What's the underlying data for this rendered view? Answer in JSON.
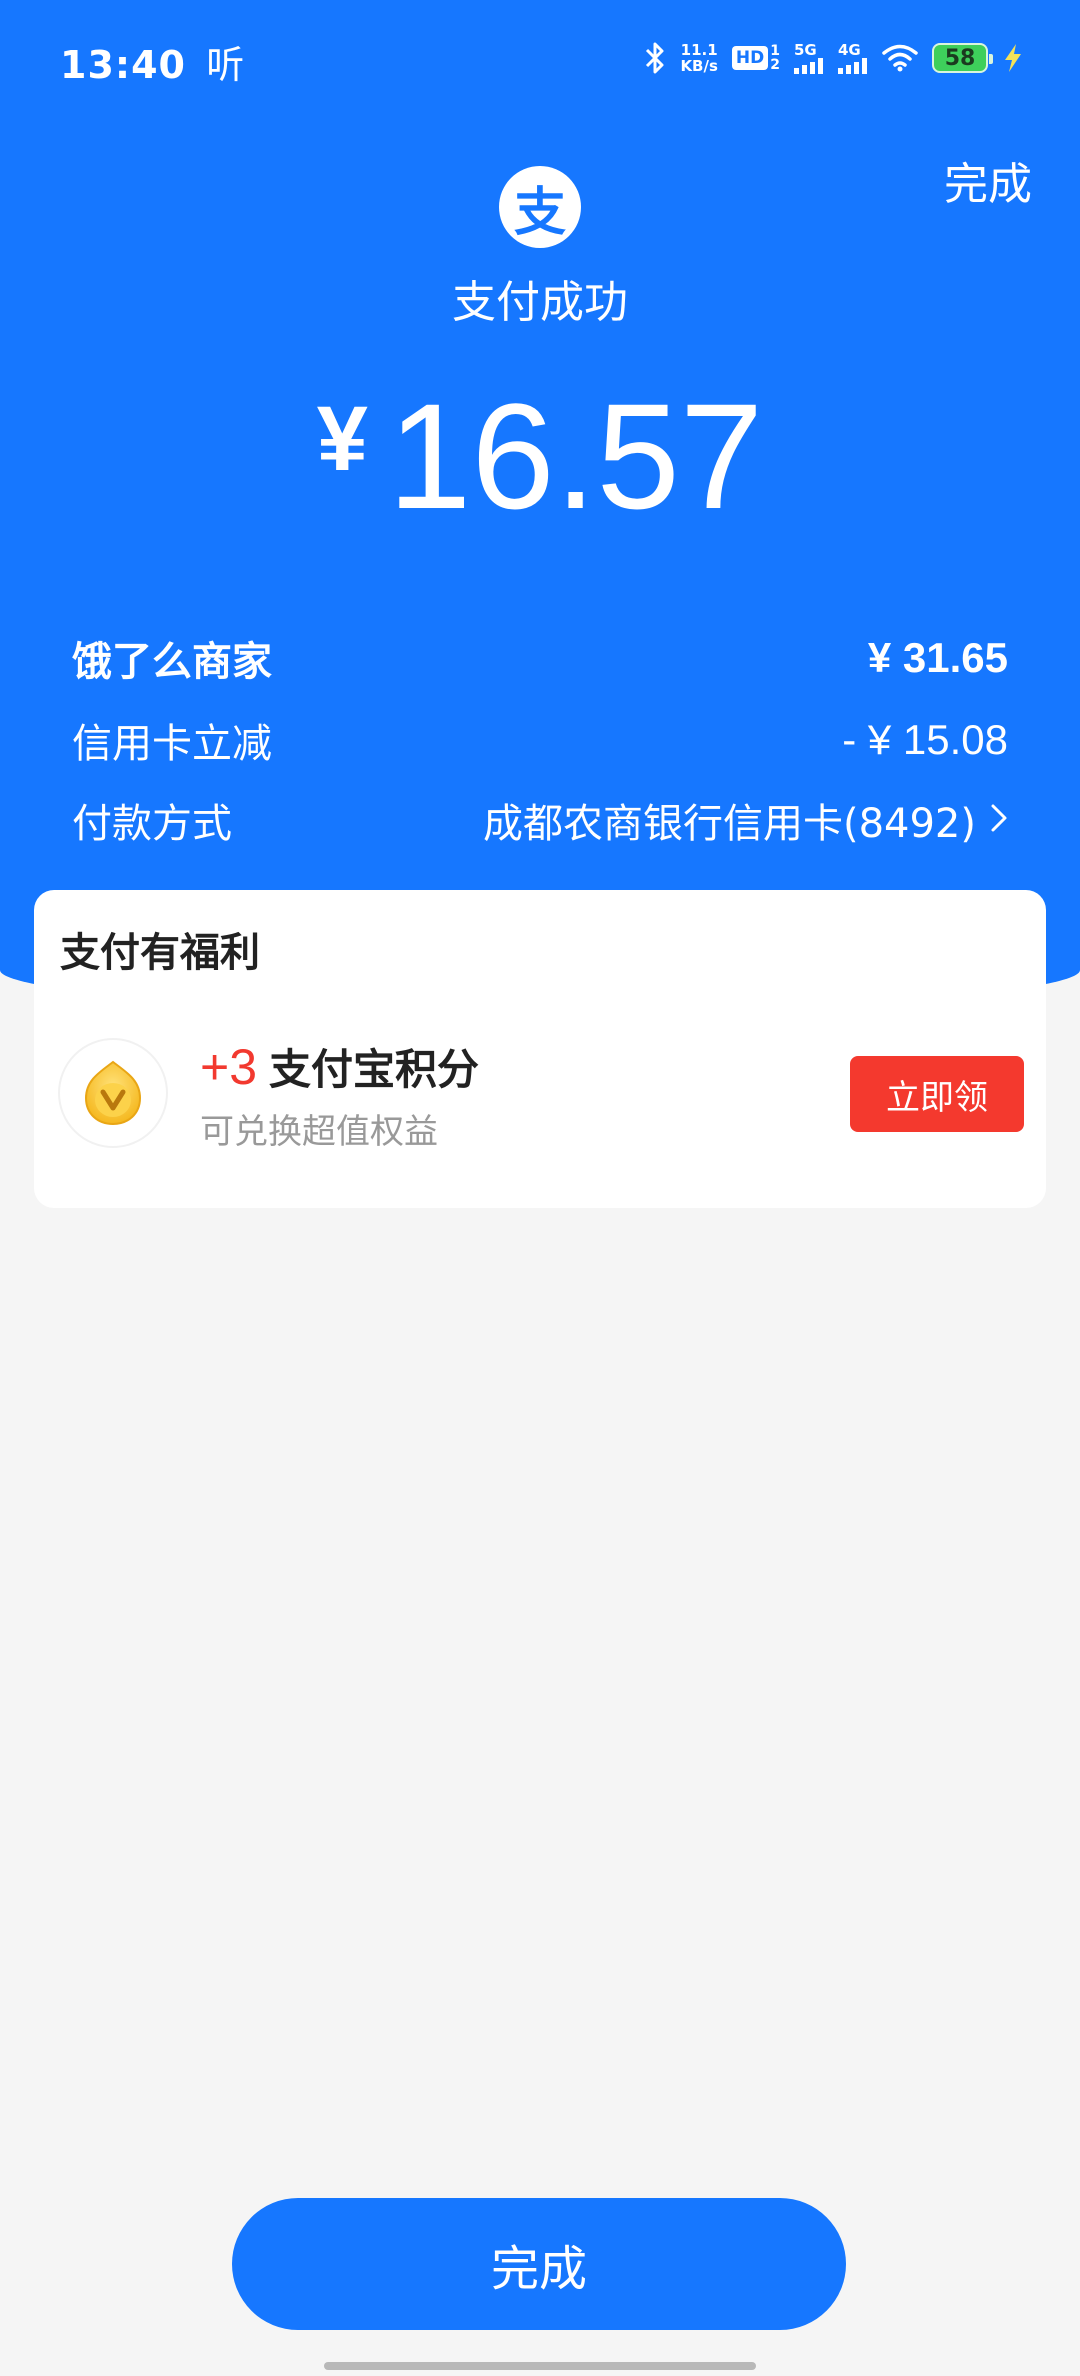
{
  "status_bar": {
    "time": "13:40",
    "extra": "听",
    "net_speed_value": "11.1",
    "net_speed_unit": "KB/s",
    "hd_label": "HD",
    "sim1_label": "5G",
    "sim2_label": "4G",
    "battery_level": "58",
    "icons": [
      "bluetooth-icon",
      "hd-icon",
      "signal-5g-icon",
      "signal-4g-icon",
      "wifi-icon",
      "battery-icon",
      "charging-icon"
    ]
  },
  "header": {
    "done_label": "完成",
    "logo_glyph": "支",
    "title": "支付成功"
  },
  "amount": {
    "currency": "¥",
    "value": "16.57"
  },
  "details": {
    "merchant_label": "饿了么商家",
    "merchant_value": "¥ 31.65",
    "discount_label": "信用卡立减",
    "discount_value": "- ¥ 15.08",
    "method_label": "付款方式",
    "method_value": "成都农商银行信用卡(8492)"
  },
  "benefits": {
    "title": "支付有福利",
    "coin_icon": "v-coin-icon",
    "points_amount": "+3",
    "points_label": "支付宝积分",
    "subtitle": "可兑换超值权益",
    "claim_label": "立即领"
  },
  "footer": {
    "done_label": "完成"
  },
  "colors": {
    "brand_blue": "#1677ff",
    "accent_red": "#f4392e",
    "background": "#f5f5f5"
  }
}
